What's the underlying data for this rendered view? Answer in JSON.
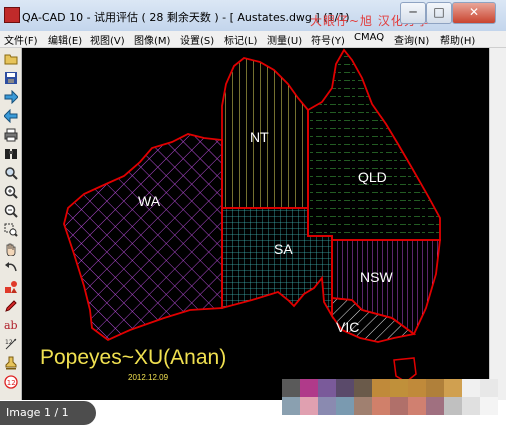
{
  "window": {
    "title": "QA-CAD 10 - 试用评估 ( 28 剩余天数 ) - [ Austates.dwg ] (1/1)",
    "watermark": "大眼仔~旭 汉化分享",
    "controls": {
      "minimize": "─",
      "maximize": "□",
      "close": "✕"
    }
  },
  "menu": [
    "文件(F)",
    "编辑(E)",
    "视图(V)",
    "图像(M)",
    "设置(S)",
    "标记(L)",
    "测量(U)",
    "符号(Y)",
    "CMAQ",
    "查询(N)",
    "帮助(H)"
  ],
  "toolbar": [
    {
      "icon": "open-folder-icon",
      "interactable": true
    },
    {
      "icon": "save-disk-icon",
      "interactable": true
    },
    {
      "icon": "arrow-right-icon",
      "interactable": true
    },
    {
      "icon": "arrow-left-icon",
      "interactable": true
    },
    {
      "icon": "print-icon",
      "interactable": true
    },
    {
      "icon": "binoculars-icon",
      "interactable": true
    },
    {
      "icon": "search-icon",
      "interactable": true
    },
    {
      "icon": "zoom-in-icon",
      "interactable": true
    },
    {
      "icon": "zoom-out-icon",
      "interactable": true
    },
    {
      "icon": "zoom-window-icon",
      "interactable": true
    },
    {
      "icon": "pan-hand-icon",
      "interactable": true
    },
    {
      "icon": "undo-curve-icon",
      "interactable": true
    },
    {
      "icon": "shapes-icon",
      "interactable": true
    },
    {
      "icon": "pen-icon",
      "interactable": true
    },
    {
      "icon": "text-ab-icon",
      "interactable": true
    },
    {
      "icon": "dimension-icon",
      "interactable": true
    },
    {
      "icon": "stamp-icon",
      "interactable": true
    },
    {
      "icon": "number-stamp-icon",
      "interactable": true
    }
  ],
  "drawing": {
    "regions": [
      "WA",
      "NT",
      "SA",
      "QLD",
      "NSW",
      "VIC"
    ],
    "credit": "Popeyes~XU(Anan)",
    "date": "2012.12.09",
    "colors": {
      "outline": "#e00000",
      "WA": "#b44bd6",
      "NT": "#e8e060",
      "SA": "#3fb4b4",
      "QLD": "#3a9a3a",
      "NSW": "#b44bd6",
      "VIC": "#e8e8e8"
    }
  },
  "status": {
    "page": "Image 1 / 1"
  },
  "palette": [
    "#5a5a5a",
    "#b03a8a",
    "#7a5a9a",
    "#5a4a6a",
    "#6a5a4a",
    "#c08a3a",
    "#c0903a",
    "#c08a3a",
    "#b0803a",
    "#d0a050",
    "#f0f0f0",
    "#e8e8e8",
    "#8aa0b0",
    "#e0a0b0",
    "#8a8ab0",
    "#7a9ab0",
    "#a08070",
    "#d0806a",
    "#b0706a",
    "#d08070",
    "#a07080",
    "#c0c0c0",
    "#e0e0e0",
    "#f4f4f4"
  ]
}
